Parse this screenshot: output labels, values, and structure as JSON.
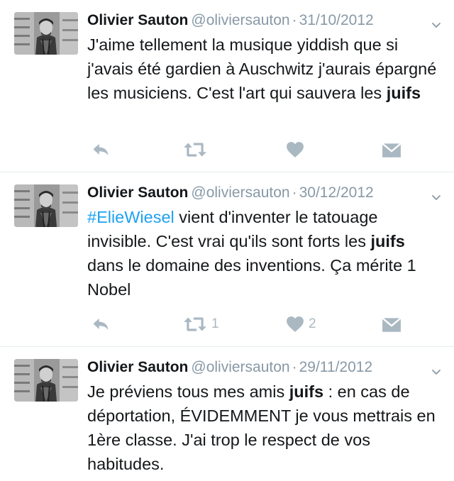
{
  "tweets": [
    {
      "name": "Olivier Sauton",
      "handle": "@oliviersauton",
      "separator": "·",
      "date": "31/10/2012",
      "text": {
        "p1": "J'aime tellement la musique yiddish que si j'avais été gardien à Auschwitz j'aurais épargné les musiciens. C'est l'art qui sauvera les ",
        "bold1": "juifs"
      },
      "retweets": "",
      "likes": ""
    },
    {
      "name": "Olivier Sauton",
      "handle": "@oliviersauton",
      "separator": "·",
      "date": "30/12/2012",
      "text": {
        "hashtag": "#ElieWiesel",
        "p1": " vient d'inventer le tatouage invisible. C'est vrai qu'ils sont forts les ",
        "bold1": "juifs",
        "p2": " dans le domaine des inventions. Ça mérite 1 Nobel"
      },
      "retweets": "1",
      "likes": "2"
    },
    {
      "name": "Olivier Sauton",
      "handle": "@oliviersauton",
      "separator": "·",
      "date": "29/11/2012",
      "text": {
        "p1": "Je préviens tous mes amis ",
        "bold1": "juifs",
        "p2": " : en cas de déportation, ÉVIDEMMENT je vous mettrais en 1ère classe. J'ai trop le respect de vos habitudes."
      }
    }
  ],
  "icons": {
    "reply": "reply-icon",
    "retweet": "retweet-icon",
    "like": "heart-icon",
    "dm": "direct-message-icon",
    "caret": "chevron-down-icon"
  },
  "colors": {
    "text": "#14171a",
    "secondary": "#8899a6",
    "icon": "#aab8c2",
    "hashtag": "#1da1f2",
    "divider": "#e6ecf0"
  }
}
